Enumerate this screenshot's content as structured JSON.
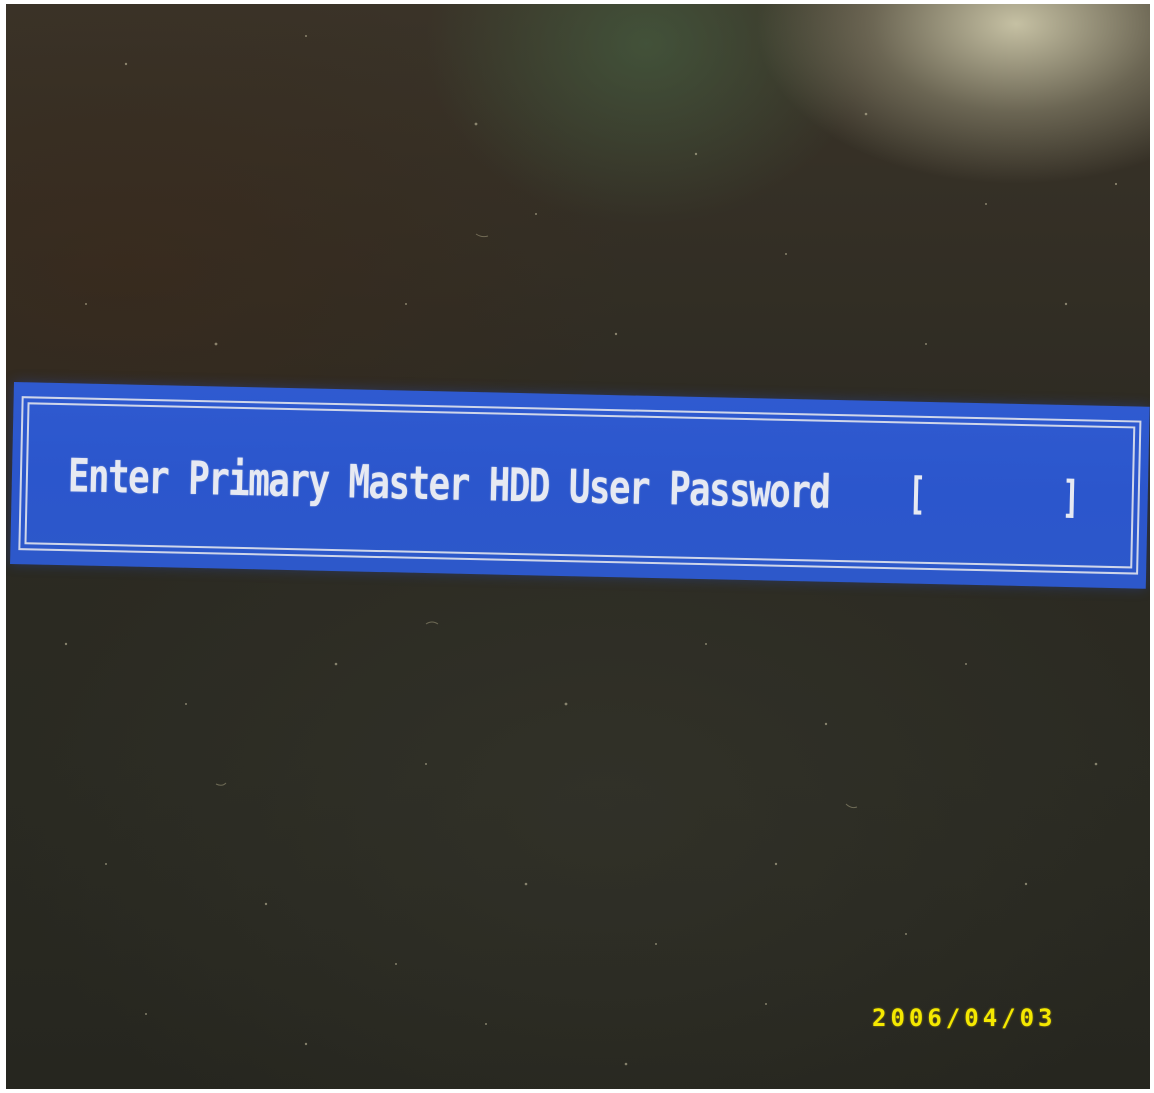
{
  "bios_prompt": {
    "label": "Enter Primary Master HDD User Password",
    "open_bracket": "[",
    "close_bracket": "]",
    "password_value": ""
  },
  "photo": {
    "date_stamp": "2006/04/03"
  },
  "colors": {
    "dialog_background": "#2f5ad0",
    "dialog_text": "#e6e9f2",
    "screen_background": "#2c2a22",
    "date_stamp": "#f4e800"
  }
}
